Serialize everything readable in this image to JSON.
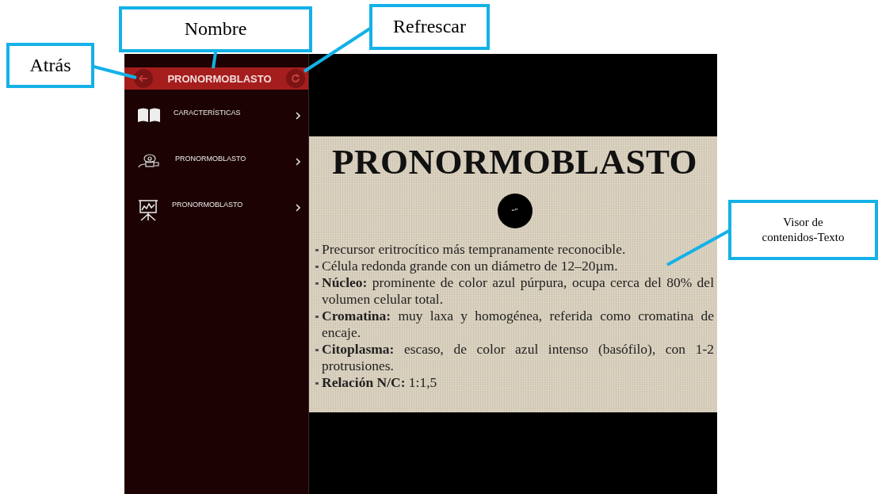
{
  "annotations": [
    {
      "kind": "back",
      "label": "Atrás"
    },
    {
      "kind": "name",
      "label": "Nombre"
    },
    {
      "kind": "refresh",
      "label": "Refrescar"
    },
    {
      "kind": "viewer",
      "label": "Visor de contenidos-Texto"
    }
  ],
  "header": {
    "title": "PRONORMOBLASTO"
  },
  "menu": [
    {
      "kind": "book",
      "label": "CARACTERÍSTICAS"
    },
    {
      "kind": "device",
      "label": "PRONORMOBLASTO"
    },
    {
      "kind": "presentation",
      "label": "PRONORMOBLASTO"
    }
  ],
  "slide": {
    "title": "PRONORMOBLASTO",
    "quote_badge": "“”",
    "bullets": [
      "Precursor eritrocítico más tempranamente reconocible.",
      "Célula redonda grande con un diámetro de 12–20µm.",
      "**Núcleo:** prominente de color azul púrpura, ocupa cerca del 80% del volumen celular total.",
      "**Cromatina:** muy laxa y homogénea, referida como cromatina de encaje.",
      "**Citoplasma:** escaso, de color azul intenso (basófilo), con 1-2 protrusiones.",
      "**Relación N/C:** 1:1,5"
    ]
  }
}
